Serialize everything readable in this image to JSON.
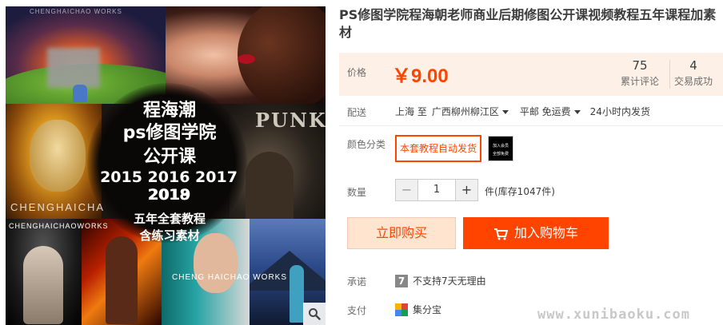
{
  "gallery": {
    "watermark_top": "CHENGHAICHAO WORKS",
    "watermark_left": "CHENGHAICHA",
    "watermark_bottom_left": "CHENGHAICHAOWORKS",
    "watermark_bottom_mid": "CHENG HAICHAO WORKS",
    "punk_word": "PUNK",
    "headline": [
      "程海潮",
      "ps修图学院",
      "公开课",
      "2015 2016 2017 2018",
      "2019",
      "五年全套教程",
      "含练习素材"
    ],
    "zoom_icon": "magnifier-icon"
  },
  "product": {
    "title": "PS修图学院程海朝老师商业后期修图公开课视频教程五年课程加素材"
  },
  "price": {
    "label": "价格",
    "value": "￥9.00",
    "color": "#ff4400",
    "stats": [
      {
        "num": "75",
        "label": "累计评论"
      },
      {
        "num": "4",
        "label": "交易成功"
      }
    ]
  },
  "shipping": {
    "label": "配送",
    "from": "上海 至",
    "to": "广西柳州柳江区",
    "method": "平邮 免运费",
    "time": "24小时内发货"
  },
  "sku": {
    "label": "颜色分类",
    "selected": "本套教程自动发货",
    "thumb_lines": [
      "加入会员",
      "全部免费"
    ]
  },
  "quantity": {
    "label": "数量",
    "minus": "−",
    "value": "1",
    "plus": "+",
    "stock": "件(库存1047件)"
  },
  "actions": {
    "buy_now": "立即购买",
    "add_to_cart": "加入购物车"
  },
  "promise": {
    "label": "承诺",
    "icon_text": "7",
    "text": "不支持7天无理由"
  },
  "payment": {
    "label": "支付",
    "text": "集分宝"
  },
  "site_watermark": "www.xunibaoku.com"
}
